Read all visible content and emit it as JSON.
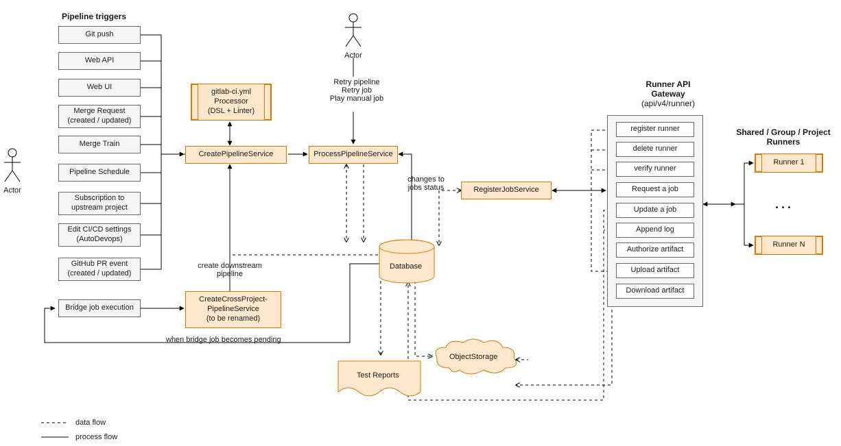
{
  "headings": {
    "triggers": "Pipeline triggers",
    "runner_gateway_l1": "Runner API",
    "runner_gateway_l2": "Gateway",
    "runner_gateway_l3": "(api/v4/runner)",
    "runners_l1": "Shared / Group / Project",
    "runners_l2": "Runners"
  },
  "actor_label": "Actor",
  "triggers": [
    "Git push",
    "Web API",
    "Web UI",
    "Merge Request\n(created / updated)",
    "Merge Train",
    "Pipeline Schedule",
    "Subscription to\nupstream project",
    "Edit CI/CD settings\n(AutoDevops)",
    "GitHub PR event\n(created / updated)"
  ],
  "bridge_job": "Bridge job execution",
  "processor_l1": "gitlab-ci.yml",
  "processor_l2": "Processor",
  "processor_l3": "(DSL + Linter)",
  "create_pipeline": "CreatePipelineService",
  "process_pipeline": "ProcessPipelineService",
  "cross_project_l1": "CreateCrossProject-",
  "cross_project_l2": "PipelineService",
  "cross_project_l3": "(to be renamed)",
  "register_job": "RegisterJobService",
  "database": "Database",
  "test_reports": "Test Reports",
  "object_storage": "ObjectStorage",
  "runner_api": [
    "register runner",
    "delete runner",
    "verify runner",
    "Request a job",
    "Update a job",
    "Append log",
    "Authorize artifact",
    "Upload artifact",
    "Download artifact"
  ],
  "runner1": "Runner 1",
  "runnerN": "Runner N",
  "runner_dots": "...",
  "retry_l1": "Retry pipeline",
  "retry_l2": "Retry job",
  "retry_l3": "Play manual job",
  "create_downstream_l1": "create downstream",
  "create_downstream_l2": "pipeline",
  "bridge_pending": "when bridge job becomes pending",
  "changes_l1": "changes to",
  "changes_l2": "jobs status",
  "legend_data": "data flow",
  "legend_process": "process flow"
}
